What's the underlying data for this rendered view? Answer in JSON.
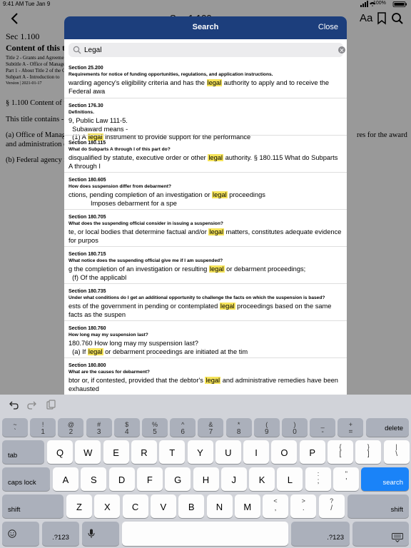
{
  "status_bar": {
    "time": "9:41 AM",
    "date": "Tue Jan 9",
    "battery": "100%"
  },
  "nav": {
    "title": "Sec 1.100",
    "font_button": "Aa"
  },
  "document": {
    "section": "Sec 1.100",
    "content_title": "Content of this title",
    "meta_lines": [
      "Title 2 - Grants and Agreements",
      "Subtitle A - Office of Management and Budget Guidance for Grants and Agreements",
      "Part 1 - About Title 2 of the Code of Federal Regulations and Subtitle A",
      "Subpart A - Introduction to",
      "Version | 2021-01-17"
    ],
    "paragraphs": [
      "§ 1.100 Content of this title.",
      "This title contains -",
      "(a) Office of Management and Budget (OMB) guidance to Federal agencies on policies and procedu",
      "and administration of",
      "(b) Federal agency regulations"
    ],
    "right_text": "res for the award"
  },
  "search": {
    "title": "Search",
    "close_label": "Close",
    "query": "Legal",
    "results": [
      {
        "section": "Section 25.200",
        "question": "Requirements for notice of funding opportunities, regulations, and application instructions.",
        "before": "warding agency's eligibility criteria and has the ",
        "match": "legal",
        "after": " authority to apply and to receive the Federal awa"
      },
      {
        "section": "Section 176.30",
        "question": "Definitions.",
        "before": "9, Public Law 111-5.\n  Subaward means -\n  (1) A ",
        "match": "legal",
        "after": " instrument to provide support for the performance"
      },
      {
        "section": "Section 180.115",
        "question": "What do Subparts A through I of this part do?",
        "before": "disqualified by statute, executive order or other ",
        "match": "legal",
        "after": " authority. § 180.115 What do Subparts A through I"
      },
      {
        "section": "Section 180.605",
        "question": "How does suspension differ from debarment?",
        "before": "ctions, pending completion of an investigation or ",
        "match": "legal",
        "after": " proceedings\n            Imposes debarment for a spe"
      },
      {
        "section": "Section 180.705",
        "question": "What does the suspending official consider in issuing a suspension?",
        "before": "te, or local bodies that determine factual and/or ",
        "match": "legal",
        "after": " matters, constitutes adequate evidence for purpos"
      },
      {
        "section": "Section 180.715",
        "question": "What notice does the suspending official give me if I am suspended?",
        "before": "g the completion of an investigation or resulting ",
        "match": "legal",
        "after": " or debarment proceedings;\n  (f) Of the applicabl"
      },
      {
        "section": "Section 180.735",
        "question": "Under what conditions do I get an additional opportunity to challenge the facts on which the suspension is based?",
        "before": "ests of the government in pending or contemplated ",
        "match": "legal",
        "after": " proceedings based on the same facts as the suspen"
      },
      {
        "section": "Section 180.760",
        "question": "How long may my suspension last?",
        "before": "180.760 How long may my suspension last?\n  (a) If ",
        "match": "legal",
        "after": " or debarment proceedings are initiated at the tim"
      },
      {
        "section": "Section 180.800",
        "question": "What are the causes for debarment?",
        "before": "btor or, if contested, provided that the debtor's ",
        "match": "legal",
        "after": " and administrative remedies have been exhausted"
      }
    ]
  },
  "keyboard": {
    "number_row": [
      {
        "top": "~",
        "bottom": "`"
      },
      {
        "top": "!",
        "bottom": "1"
      },
      {
        "top": "@",
        "bottom": "2"
      },
      {
        "top": "#",
        "bottom": "3"
      },
      {
        "top": "$",
        "bottom": "4"
      },
      {
        "top": "%",
        "bottom": "5"
      },
      {
        "top": "^",
        "bottom": "6"
      },
      {
        "top": "&",
        "bottom": "7"
      },
      {
        "top": "*",
        "bottom": "8"
      },
      {
        "top": "(",
        "bottom": "9"
      },
      {
        "top": ")",
        "bottom": "0"
      },
      {
        "top": "_",
        "bottom": "-"
      },
      {
        "top": "+",
        "bottom": "="
      }
    ],
    "delete_label": "delete",
    "tab_label": "tab",
    "row_q": [
      "Q",
      "W",
      "E",
      "R",
      "T",
      "Y",
      "U",
      "I",
      "O",
      "P"
    ],
    "row_q_punct": [
      {
        "top": "{",
        "bottom": "["
      },
      {
        "top": "}",
        "bottom": "]"
      },
      {
        "top": "|",
        "bottom": "\\"
      }
    ],
    "caps_label": "caps lock",
    "row_a": [
      "A",
      "S",
      "D",
      "F",
      "G",
      "H",
      "J",
      "K",
      "L"
    ],
    "row_a_punct": [
      {
        "top": ":",
        "bottom": ";"
      },
      {
        "top": "\"",
        "bottom": "'"
      }
    ],
    "search_label": "search",
    "shift_label": "shift",
    "row_z": [
      "Z",
      "X",
      "C",
      "V",
      "B",
      "N",
      "M"
    ],
    "row_z_punct": [
      {
        "top": "<",
        "bottom": ","
      },
      {
        "top": ">",
        "bottom": "."
      },
      {
        "top": "?",
        "bottom": "/"
      }
    ],
    "numbers_label": ".?123",
    "accent_color": "#1a83f8",
    "header_color": "#1c3e7c"
  }
}
